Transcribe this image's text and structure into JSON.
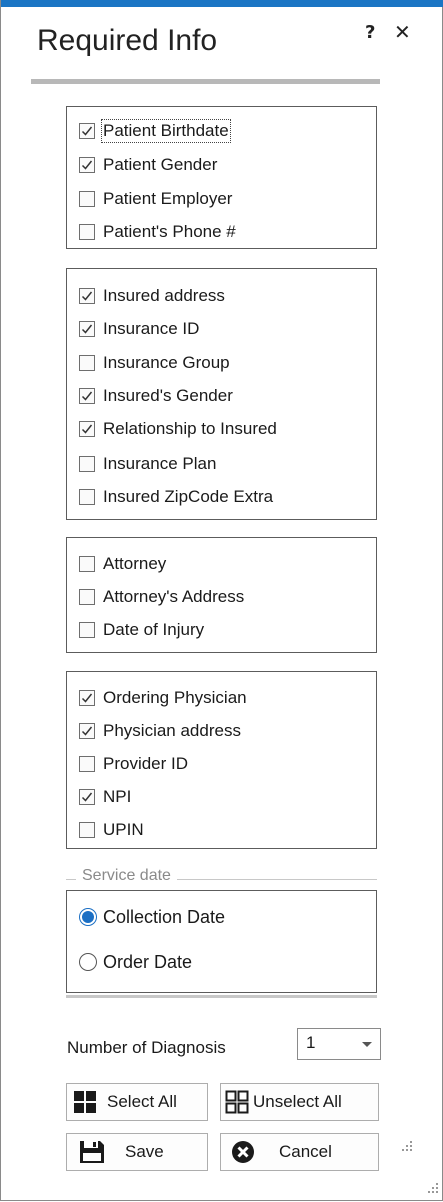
{
  "window": {
    "title": "Required Info",
    "help_label": "?",
    "close_label": "✕"
  },
  "groups": {
    "patient": [
      {
        "label": "Patient Birthdate",
        "checked": true
      },
      {
        "label": "Patient Gender",
        "checked": true
      },
      {
        "label": "Patient Employer",
        "checked": false
      },
      {
        "label": "Patient's Phone #",
        "checked": false
      }
    ],
    "insurance": [
      {
        "label": "Insured address",
        "checked": true
      },
      {
        "label": "Insurance ID",
        "checked": true
      },
      {
        "label": "Insurance Group",
        "checked": false
      },
      {
        "label": "Insured's Gender",
        "checked": true
      },
      {
        "label": "Relationship to Insured",
        "checked": true
      },
      {
        "label": "Insurance Plan",
        "checked": false
      },
      {
        "label": "Insured ZipCode Extra",
        "checked": false
      }
    ],
    "attorney": [
      {
        "label": "Attorney",
        "checked": false
      },
      {
        "label": "Attorney's Address",
        "checked": false
      },
      {
        "label": "Date of Injury",
        "checked": false
      }
    ],
    "physician": [
      {
        "label": "Ordering Physician",
        "checked": true
      },
      {
        "label": "Physician address",
        "checked": true
      },
      {
        "label": "Provider ID",
        "checked": false
      },
      {
        "label": "NPI",
        "checked": true
      },
      {
        "label": "UPIN",
        "checked": false
      }
    ]
  },
  "service_date": {
    "legend": "Service date",
    "options": [
      {
        "label": "Collection Date",
        "selected": true
      },
      {
        "label": "Order Date",
        "selected": false
      }
    ]
  },
  "diagnosis": {
    "label": "Number of Diagnosis",
    "value": "1"
  },
  "buttons": {
    "select_all": "Select All",
    "unselect_all": "Unselect All",
    "save": "Save",
    "cancel": "Cancel"
  },
  "colors": {
    "accent": "#1b75c4",
    "border": "#5c5c5c"
  }
}
